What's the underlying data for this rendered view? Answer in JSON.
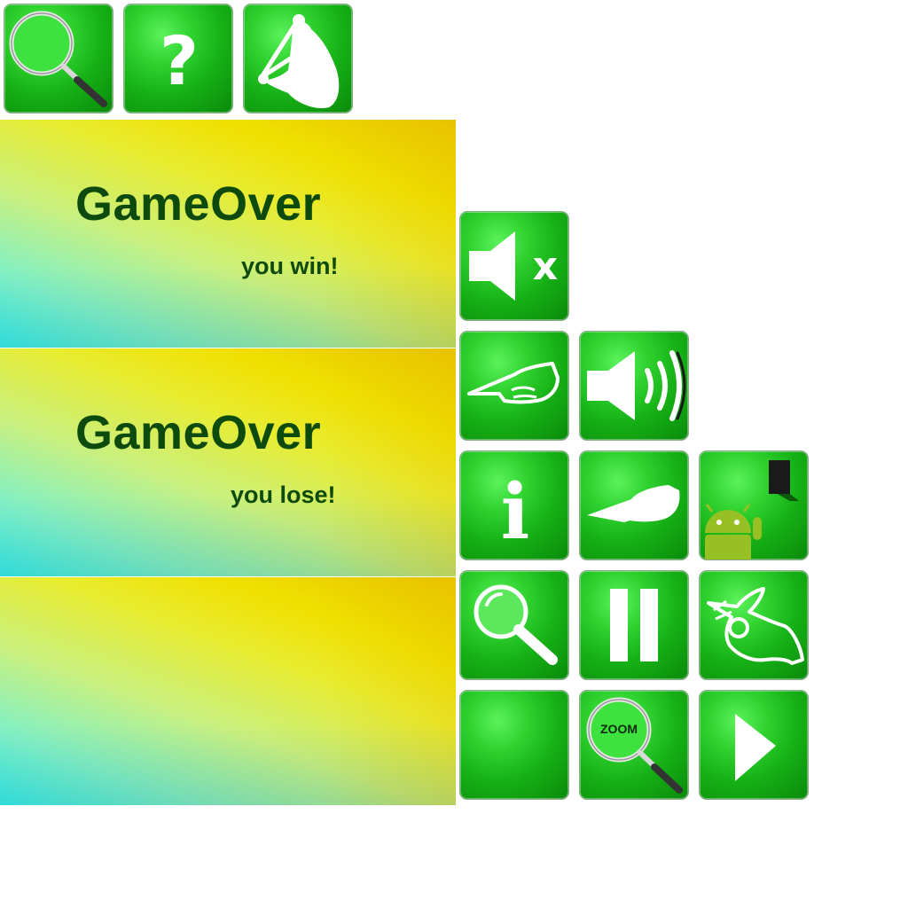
{
  "top_buttons": [
    {
      "icon": "search-icon"
    },
    {
      "icon": "help-icon",
      "glyph": "?"
    },
    {
      "icon": "grab-hand-icon"
    }
  ],
  "banners": [
    {
      "title": "GameOver",
      "subtitle": "you win!"
    },
    {
      "title": "GameOver",
      "subtitle": "you lose!"
    },
    {
      "title": "",
      "subtitle": ""
    }
  ],
  "grid_buttons": [
    {
      "icon": "sound-mute-icon",
      "glyph": "x"
    },
    {
      "icon": "pointing-hand-left-icon"
    },
    {
      "icon": "sound-on-icon"
    },
    {
      "icon": "info-icon",
      "glyph": "i"
    },
    {
      "icon": "pointing-hand-solid-icon"
    },
    {
      "icon": "android-exit-icon"
    },
    {
      "icon": "magnifier-icon"
    },
    {
      "icon": "pause-icon"
    },
    {
      "icon": "ok-hand-icon"
    },
    {
      "icon": "blank-icon"
    },
    {
      "icon": "zoom-icon",
      "label": "ZOOM"
    },
    {
      "icon": "play-icon"
    }
  ],
  "colors": {
    "tile_green": "#16b016",
    "title_green": "#0d4a0d",
    "icon_white": "#ffffff"
  }
}
